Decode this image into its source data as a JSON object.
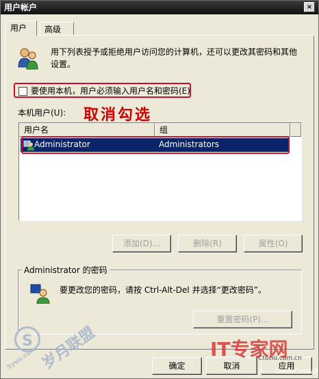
{
  "window": {
    "title": "用户帐户",
    "close_glyph": "×"
  },
  "tabs": [
    {
      "label": "用户"
    },
    {
      "label": "高级"
    }
  ],
  "users_tab": {
    "description": "用下列表授予或拒绝用户访问您的计算机，还可以更改其密码和其他设置。",
    "require_login_label": "要使用本机，用户必须输入用户名和密码(E)",
    "require_login_checked": false,
    "annotation": "取消勾选",
    "local_users_label": "本机用户(U):",
    "columns": [
      "用户名",
      "组"
    ],
    "rows": [
      {
        "name": "Administrator",
        "group": "Administrators",
        "selected": true
      }
    ],
    "buttons": {
      "add": "添加(D)...",
      "remove": "删除(R)",
      "properties": "属性(O)"
    },
    "password_group": {
      "title": "Administrator 的密码",
      "text": "要更改您的密码，请按 Ctrl-Alt-Del 并选择“更改密码”。",
      "reset_button": "重置密码(P)..."
    }
  },
  "dialog_buttons": {
    "ok": "确定",
    "cancel": "取消",
    "apply": "应用"
  },
  "watermarks": {
    "left": "S",
    "left_caption": "5yuu.com",
    "left_cn": "岁月联盟",
    "right_text": "IT专家网",
    "right_small": "DedeCmsV3",
    "right_caption": "Ctocio.com.cn"
  },
  "colors": {
    "selection": "#0a246a",
    "annotation": "#d10000",
    "highlight_box": "#c8102e"
  }
}
